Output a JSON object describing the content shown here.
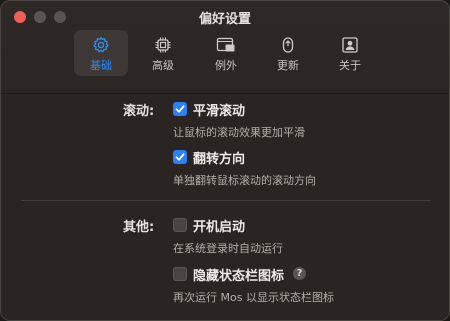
{
  "window": {
    "title": "偏好设置"
  },
  "tabs": [
    {
      "label": "基础",
      "icon": "gear-icon",
      "active": true
    },
    {
      "label": "高级",
      "icon": "chip-icon",
      "active": false
    },
    {
      "label": "例外",
      "icon": "window-exception-icon",
      "active": false
    },
    {
      "label": "更新",
      "icon": "update-arrow-icon",
      "active": false
    },
    {
      "label": "关于",
      "icon": "person-card-icon",
      "active": false
    }
  ],
  "scroll_section": {
    "label": "滚动:",
    "options": [
      {
        "label": "平滑滚动",
        "checked": true,
        "description": "让鼠标的滚动效果更加平滑"
      },
      {
        "label": "翻转方向",
        "checked": true,
        "description": "单独翻转鼠标滚动的滚动方向"
      }
    ]
  },
  "other_section": {
    "label": "其他:",
    "options": [
      {
        "label": "开机启动",
        "checked": false,
        "description": "在系统登录时自动运行"
      },
      {
        "label": "隐藏状态栏图标",
        "checked": false,
        "description": "再次运行 Mos 以显示状态栏图标",
        "help": "?"
      }
    ]
  },
  "colors": {
    "accent": "#2e8cf5",
    "checkbox_on": "#2d7ff5",
    "close": "#ed5f57"
  }
}
